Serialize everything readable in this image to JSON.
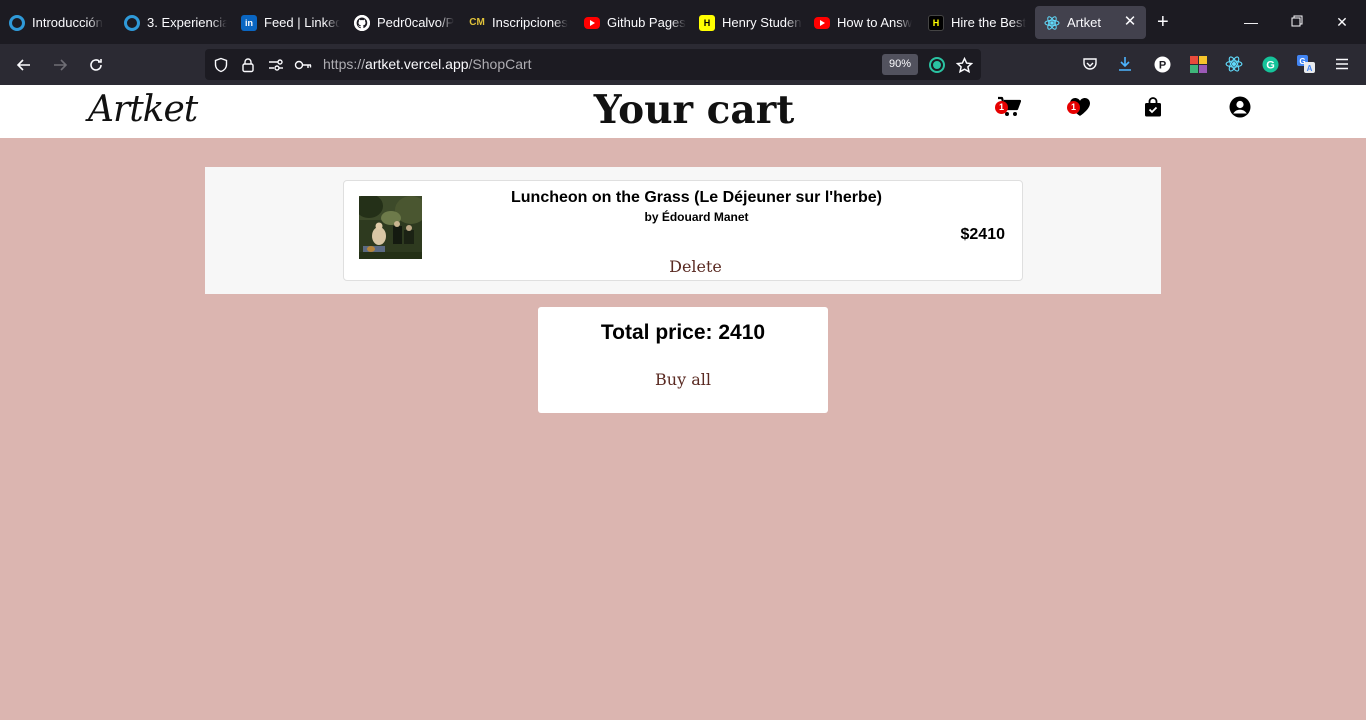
{
  "browser": {
    "tabs": [
      {
        "title": "Introducción",
        "icon": "ring-favicon-icon"
      },
      {
        "title": "3. Experiencia",
        "icon": "ring-favicon-icon"
      },
      {
        "title": "Feed | LinkedIn",
        "icon": "linkedin-icon",
        "fav_text": "in"
      },
      {
        "title": "Pedr0calvo/P",
        "icon": "github-icon"
      },
      {
        "title": "Inscripciones",
        "icon": "cm-favicon-icon",
        "fav_text": "CM"
      },
      {
        "title": "Github Pages",
        "icon": "youtube-icon"
      },
      {
        "title": "Henry Studen",
        "icon": "henry-favicon-icon",
        "fav_text": "H"
      },
      {
        "title": "How to Answ",
        "icon": "youtube-icon"
      },
      {
        "title": "Hire the Best",
        "icon": "henry-hire-favicon-icon",
        "fav_text": "H"
      },
      {
        "title": "Artket",
        "icon": "react-favicon-icon",
        "active": true
      }
    ],
    "url_dim_prefix": "https://",
    "url_host": "artket.vercel.app",
    "url_path": "/ShopCart",
    "zoom": "90%"
  },
  "site": {
    "logo": "Artket",
    "page_title": "Your cart",
    "cart_count": "1",
    "favorites_count": "1"
  },
  "cart": {
    "items": [
      {
        "title": "Luncheon on the Grass (Le Déjeuner sur l'herbe)",
        "artist": "by Édouard Manet",
        "price": "$2410",
        "delete_label": "Delete"
      }
    ],
    "total_label": "Total price: 2410",
    "buy_label": "Buy all"
  },
  "colors": {
    "page_background": "#dbb5b0",
    "button_text": "#5a2a22",
    "badge": "#e60000"
  }
}
